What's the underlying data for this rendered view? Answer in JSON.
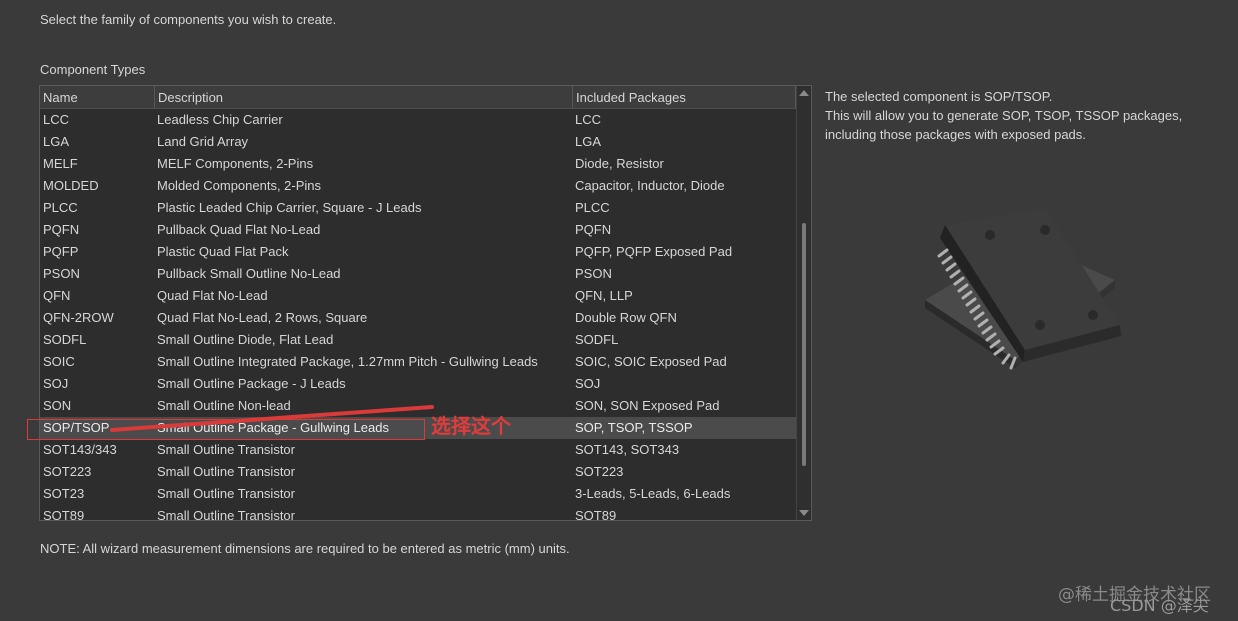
{
  "intro_text": "Select the family of components you wish to create.",
  "component_types_label": "Component Types",
  "table": {
    "headers": {
      "name": "Name",
      "description": "Description",
      "packages": "Included Packages"
    },
    "rows": [
      {
        "name": "LCC",
        "description": "Leadless Chip Carrier",
        "packages": "LCC"
      },
      {
        "name": "LGA",
        "description": "Land Grid Array",
        "packages": "LGA"
      },
      {
        "name": "MELF",
        "description": "MELF Components, 2-Pins",
        "packages": "Diode, Resistor"
      },
      {
        "name": "MOLDED",
        "description": "Molded Components, 2-Pins",
        "packages": "Capacitor, Inductor, Diode"
      },
      {
        "name": "PLCC",
        "description": "Plastic Leaded Chip Carrier, Square - J Leads",
        "packages": "PLCC"
      },
      {
        "name": "PQFN",
        "description": "Pullback Quad Flat No-Lead",
        "packages": "PQFN"
      },
      {
        "name": "PQFP",
        "description": "Plastic Quad Flat Pack",
        "packages": "PQFP, PQFP Exposed Pad"
      },
      {
        "name": "PSON",
        "description": "Pullback Small Outline No-Lead",
        "packages": "PSON"
      },
      {
        "name": "QFN",
        "description": "Quad Flat No-Lead",
        "packages": "QFN, LLP"
      },
      {
        "name": "QFN-2ROW",
        "description": "Quad Flat No-Lead, 2 Rows, Square",
        "packages": "Double Row QFN"
      },
      {
        "name": "SODFL",
        "description": "Small Outline Diode, Flat Lead",
        "packages": "SODFL"
      },
      {
        "name": "SOIC",
        "description": "Small Outline Integrated Package, 1.27mm Pitch - Gullwing Leads",
        "packages": "SOIC, SOIC Exposed Pad"
      },
      {
        "name": "SOJ",
        "description": "Small Outline Package - J Leads",
        "packages": "SOJ"
      },
      {
        "name": "SON",
        "description": "Small Outline Non-lead",
        "packages": "SON, SON Exposed Pad"
      },
      {
        "name": "SOP/TSOP",
        "description": "Small Outline Package - Gullwing Leads",
        "packages": "SOP, TSOP, TSSOP",
        "selected": true
      },
      {
        "name": "SOT143/343",
        "description": "Small Outline Transistor",
        "packages": "SOT143, SOT343"
      },
      {
        "name": "SOT223",
        "description": "Small Outline Transistor",
        "packages": "SOT223"
      },
      {
        "name": "SOT23",
        "description": "Small Outline Transistor",
        "packages": "3-Leads, 5-Leads, 6-Leads"
      },
      {
        "name": "SOT89",
        "description": "Small Outline Transistor",
        "packages": "SOT89"
      }
    ]
  },
  "description_panel": {
    "line1": "The selected component is SOP/TSOP.",
    "line2": "This will allow you to generate SOP, TSOP, TSSOP packages,",
    "line3": "including those packages with exposed pads."
  },
  "note_text": "NOTE: All wizard measurement dimensions are required to be entered as metric (mm) units.",
  "annotation": {
    "text": "选择这个",
    "color": "#e23b3b"
  },
  "watermark": {
    "line1": "@稀土掘金技术社区",
    "line2": "CSDN @泽尖"
  },
  "icons": {
    "scroll_up": "triangle-up-icon",
    "scroll_down": "triangle-down-icon",
    "preview": "sop-chip-image"
  }
}
